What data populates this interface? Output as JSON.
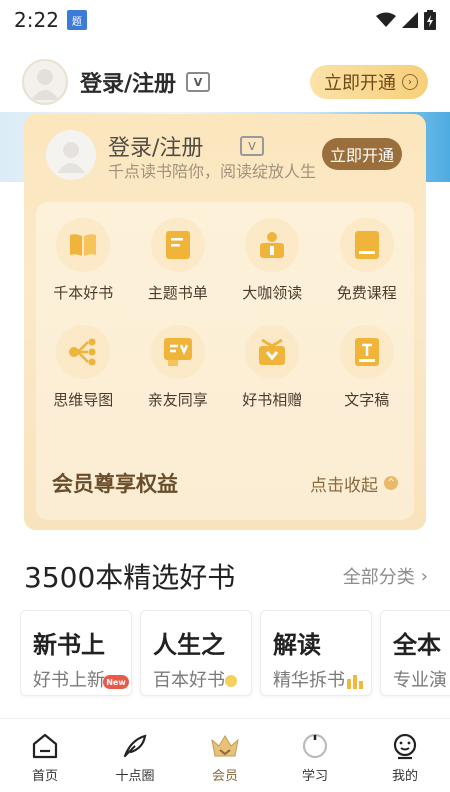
{
  "status_bar": {
    "time": "2:22",
    "app_icon_label": "题"
  },
  "header": {
    "login_label": "登录/注册",
    "badge_label": "V",
    "open_label": "立即开通"
  },
  "card": {
    "login_label": "登录/注册",
    "badge_label": "V",
    "subtitle": "千点读书陪你，阅读绽放人生",
    "open_label": "立即开通",
    "benefits": [
      {
        "label": "千本好书",
        "icon": "open-book-icon"
      },
      {
        "label": "主题书单",
        "icon": "booklist-icon"
      },
      {
        "label": "大咖领读",
        "icon": "reader-icon"
      },
      {
        "label": "免费课程",
        "icon": "course-book-icon"
      },
      {
        "label": "思维导图",
        "icon": "mindmap-icon"
      },
      {
        "label": "亲友同享",
        "icon": "share-icon"
      },
      {
        "label": "好书相赠",
        "icon": "gift-icon"
      },
      {
        "label": "文字稿",
        "icon": "transcript-icon"
      }
    ],
    "benefit_title": "会员尊享权益",
    "collapse_label": "点击收起"
  },
  "section": {
    "title": "3500本精选好书",
    "more_label": "全部分类"
  },
  "categories": [
    {
      "title": "新书上",
      "subtitle": "好书上新",
      "tag": "New"
    },
    {
      "title": "人生之",
      "subtitle": "百本好书"
    },
    {
      "title": "解读",
      "subtitle": "精华拆书"
    },
    {
      "title": "全本",
      "subtitle": "专业演"
    }
  ],
  "tabs": [
    {
      "label": "首页",
      "icon": "home-icon"
    },
    {
      "label": "十点圈",
      "icon": "feather-icon"
    },
    {
      "label": "会员",
      "icon": "crown-icon",
      "active": true
    },
    {
      "label": "学习",
      "icon": "study-icon"
    },
    {
      "label": "我的",
      "icon": "profile-icon"
    }
  ],
  "colors": {
    "accent": "#f7cf7a",
    "brand_brown": "#9a6f3b",
    "new_tag": "#e85b4a"
  }
}
